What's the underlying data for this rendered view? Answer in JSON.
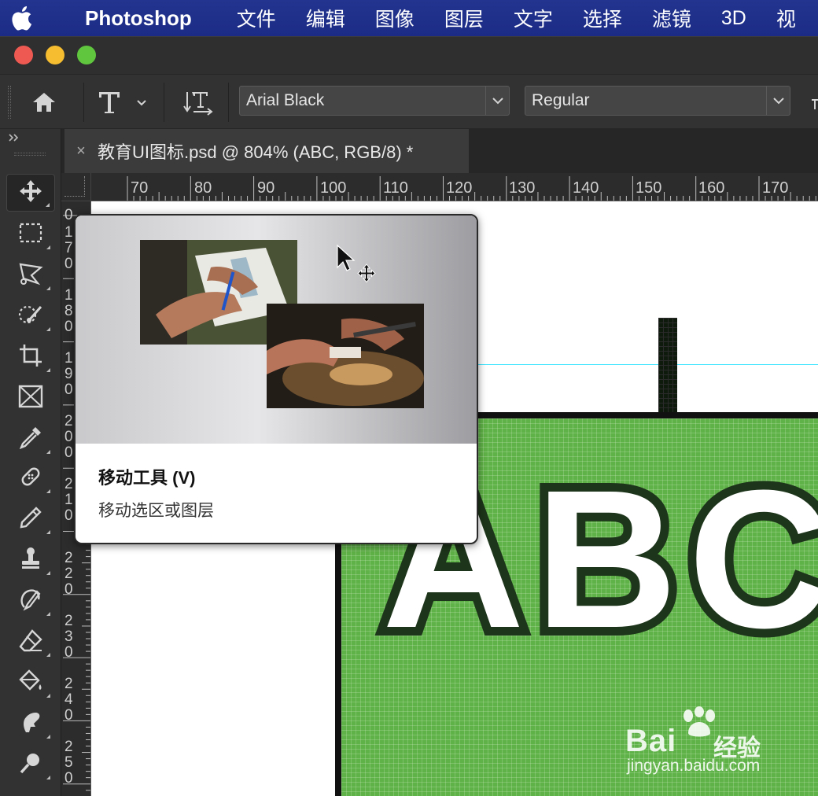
{
  "menubar": {
    "app_name": "Photoshop",
    "items": [
      "文件",
      "编辑",
      "图像",
      "图层",
      "文字",
      "选择",
      "滤镜",
      "3D",
      "视"
    ]
  },
  "options_bar": {
    "font_family": "Arial Black",
    "font_style": "Regular"
  },
  "document": {
    "tab_close": "×",
    "tab_title": "教育UI图标.psd @ 804% (ABC, RGB/8) *"
  },
  "ruler": {
    "top_numbers": [
      "70",
      "80",
      "90",
      "100",
      "110",
      "120",
      "130",
      "140",
      "150",
      "160",
      "170"
    ],
    "left_numbers": [
      "0",
      "1 7 0",
      "1 8 0",
      "1 9 0",
      "2 0 0",
      "2 1 0",
      "2 2 0",
      "2 3 0",
      "2 4 0",
      "2 5 0"
    ]
  },
  "canvas": {
    "artwork_text": "ABC"
  },
  "tooltip": {
    "title": "移动工具 (V)",
    "description": "移动选区或图层"
  },
  "watermark": {
    "brand": "Bai",
    "brand_suffix": "经验",
    "url": "jingyan.baidu.com"
  },
  "colors": {
    "menubar": "#22348f",
    "canvas_green": "#5fb247",
    "guide": "#44e6ff"
  }
}
